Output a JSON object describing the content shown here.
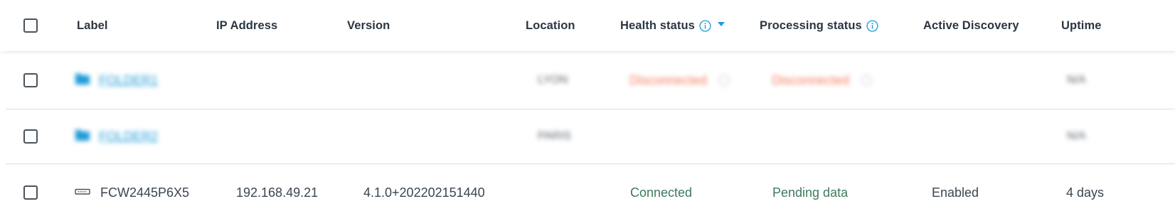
{
  "columns": {
    "label": "Label",
    "ip_address": "IP Address",
    "version": "Version",
    "location": "Location",
    "health_status": "Health status",
    "processing_status": "Processing status",
    "active_discovery": "Active Discovery",
    "uptime": "Uptime"
  },
  "sort": {
    "column": "health_status",
    "direction": "desc",
    "icon": "caret-down-icon"
  },
  "colors": {
    "accent": "#1a9bd7",
    "connected": "#3d7a5c",
    "disconnected": "#f2795a",
    "text": "#3b4550"
  },
  "rows": [
    {
      "type": "folder",
      "icon": "folder-icon",
      "label": "FOLDER1",
      "ip": "",
      "version": "",
      "location": "LYON",
      "health": "Disconnected",
      "processing": "Disconnected",
      "discovery": "",
      "uptime": "N/A"
    },
    {
      "type": "folder",
      "icon": "folder-icon",
      "label": "FOLDER2",
      "ip": "",
      "version": "",
      "location": "PARIS",
      "health": "",
      "processing": "",
      "discovery": "",
      "uptime": "N/A"
    },
    {
      "type": "device",
      "icon": "device-icon",
      "label": "FCW2445P6X5",
      "ip": "192.168.49.21",
      "version": "4.1.0+202202151440",
      "location": "",
      "health": "Connected",
      "processing": "Pending data",
      "discovery": "Enabled",
      "uptime": "4 days"
    }
  ]
}
